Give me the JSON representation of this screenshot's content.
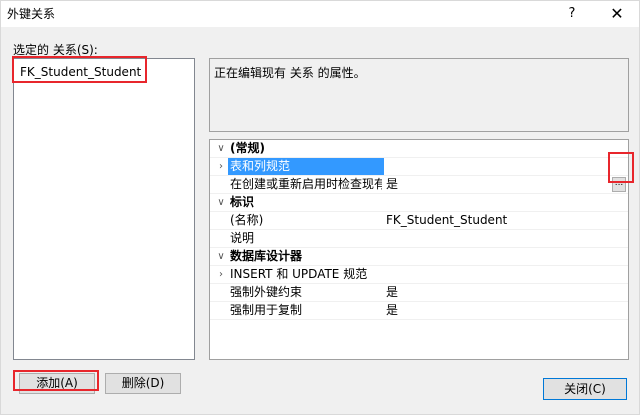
{
  "window": {
    "title": "外键关系",
    "help_glyph": "?",
    "close_glyph": "✕"
  },
  "left": {
    "label": "选定的 关系(S):",
    "relations": [
      "FK_Student_Student"
    ]
  },
  "description": "正在编辑现有 关系 的属性。",
  "grid": {
    "categories": [
      {
        "name": "(常规)",
        "rows": [
          {
            "name": "表和列规范",
            "value": "",
            "expandable": true,
            "selected": true,
            "ellipsis": "..."
          },
          {
            "name": "在创建或重新启用时检查现有数据",
            "value": "是"
          }
        ]
      },
      {
        "name": "标识",
        "rows": [
          {
            "name": "(名称)",
            "value": "FK_Student_Student"
          },
          {
            "name": "说明",
            "value": ""
          }
        ]
      },
      {
        "name": "数据库设计器",
        "rows": [
          {
            "name": "INSERT 和 UPDATE 规范",
            "value": "",
            "expandable": true
          },
          {
            "name": "强制外键约束",
            "value": "是"
          },
          {
            "name": "强制用于复制",
            "value": "是"
          }
        ]
      }
    ]
  },
  "buttons": {
    "add": "添加(A)",
    "delete": "删除(D)",
    "close": "关闭(C)"
  },
  "colors": {
    "highlight_box": "#e8262c",
    "selection": "#3399ff",
    "default_button_border": "#0078d7"
  }
}
